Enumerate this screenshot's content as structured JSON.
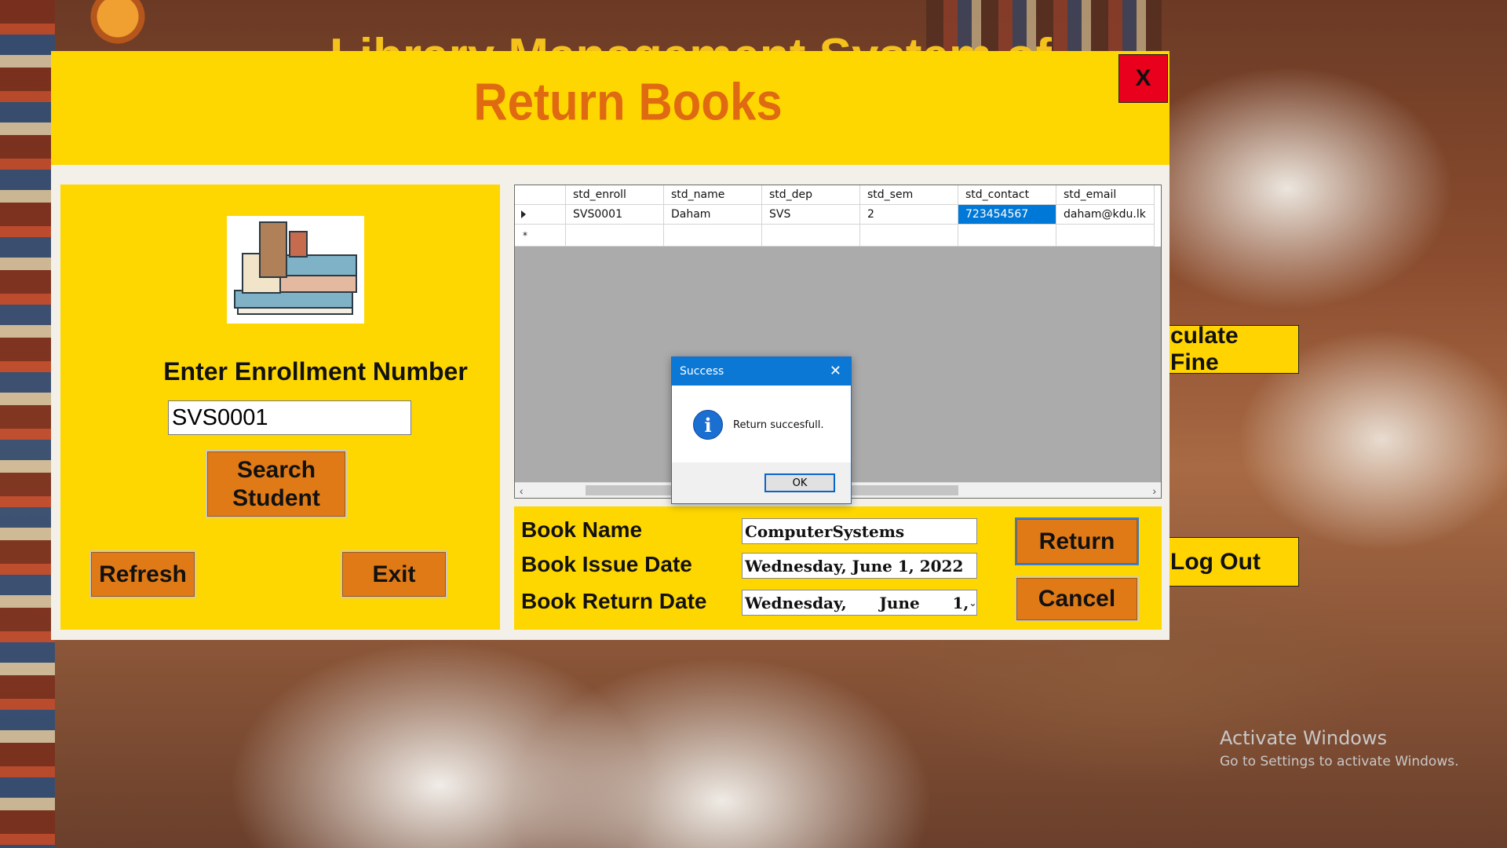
{
  "background": {
    "banner_title": "Library Management System of",
    "side_buttons": {
      "calculate_fine": "culate Fine",
      "logout": "Log Out"
    },
    "watermark": {
      "line1": "Activate Windows",
      "line2": "Go to Settings to activate Windows."
    }
  },
  "window": {
    "title": "Return Books",
    "close_label": "X",
    "enroll": {
      "label": "Enter Enrollment Number",
      "value": "SVS0001"
    },
    "buttons": {
      "search": "Search Student",
      "refresh": "Refresh",
      "exit": "Exit",
      "return": "Return",
      "cancel": "Cancel"
    },
    "grid": {
      "columns": [
        "std_enroll",
        "std_name",
        "std_dep",
        "std_sem",
        "std_contact",
        "std_email"
      ],
      "rows": [
        [
          "SVS0001",
          "Daham",
          "SVS",
          "2",
          "723454567",
          "daham@kdu.lk"
        ]
      ],
      "new_row_marker": "*"
    },
    "book": {
      "name_label": "Book Name",
      "name_value": "ComputerSystems",
      "issue_label": "Book Issue Date",
      "issue_value": "Wednesday, June 1, 2022",
      "return_label": "Book Return Date",
      "return_value": "Wednesday,      June      1,"
    }
  },
  "dialog": {
    "title": "Success",
    "message": "Return succesfull.",
    "ok": "OK"
  },
  "colors": {
    "panel_yellow": "#ffd700",
    "button_orange": "#e07a16",
    "title_orange": "#e06a12",
    "close_red": "#e8001c",
    "selection_blue": "#0078d7"
  }
}
